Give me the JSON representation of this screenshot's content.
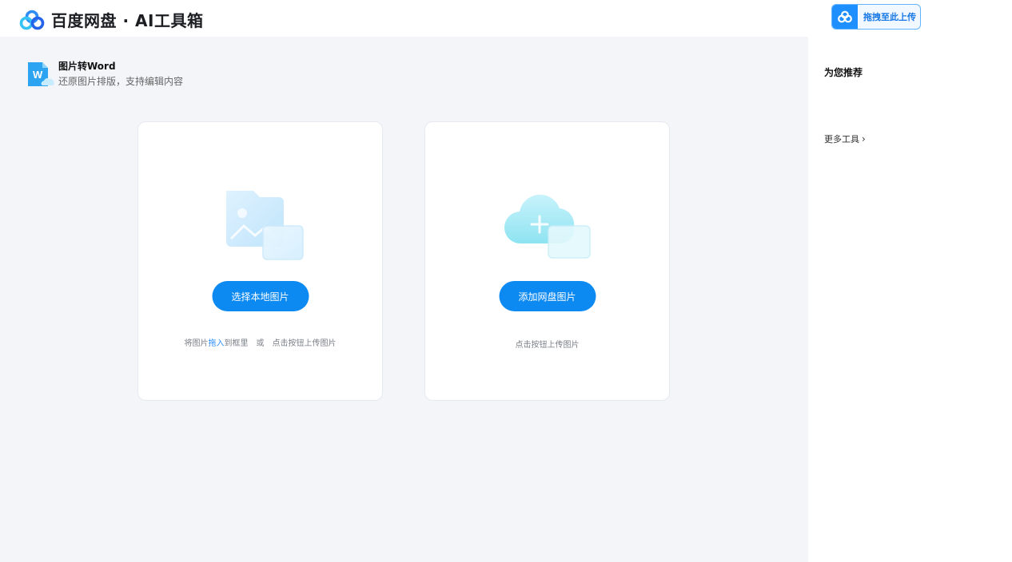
{
  "header": {
    "app_title": "百度网盘 · AI工具箱",
    "upload_drag_label": "拖拽至此上传"
  },
  "tool": {
    "name": "图片转Word",
    "description": "还原图片排版，支持编辑内容",
    "icon": "word-doc-icon"
  },
  "local_card": {
    "button_label": "选择本地图片",
    "hint_prefix": "将图片",
    "hint_link": "拖入",
    "hint_middle": "到框里",
    "hint_or": "或",
    "hint_suffix": "点击按钮上传图片",
    "icon": "image-folder-icon"
  },
  "cloud_card": {
    "button_label": "添加网盘图片",
    "hint": "点击按钮上传图片",
    "icon": "cloud-add-icon"
  },
  "sidebar": {
    "recommend_title": "为您推荐",
    "more_tools_label": "更多工具",
    "more_tools_chevron": "›"
  },
  "colors": {
    "accent": "#0d8af2",
    "background": "#f4f5f9",
    "card": "#ffffff"
  }
}
